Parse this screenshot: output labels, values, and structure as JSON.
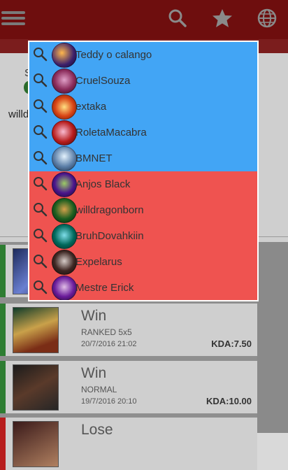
{
  "toolbar": {
    "menu_icon": "hamburger-icon",
    "search_icon": "search-icon",
    "favorite_icon": "star-icon",
    "region_icon": "globe-icon"
  },
  "profile": {
    "label_initial": "S",
    "summoner_partial": "willd"
  },
  "search_suggestions": {
    "colors": {
      "favorite": "#42a5f5",
      "recent": "#ef5350"
    },
    "favorites": [
      {
        "name": "Teddy o calango"
      },
      {
        "name": "CruelSouza"
      },
      {
        "name": "extaka"
      },
      {
        "name": "RoletaMacabra"
      },
      {
        "name": "BMNET"
      }
    ],
    "recent": [
      {
        "name": "Anjos Black"
      },
      {
        "name": "willdragonborn"
      },
      {
        "name": "BruhDovahkiin"
      },
      {
        "name": "Expelarus"
      },
      {
        "name": "Mestre Erick"
      }
    ]
  },
  "matches": [
    {
      "result": "",
      "queue": "",
      "date": "",
      "kda": ""
    },
    {
      "result": "Win",
      "queue": "RANKED 5x5",
      "date": "20/7/2016 21:02",
      "kda": "KDA:7.50"
    },
    {
      "result": "Win",
      "queue": "NORMAL",
      "date": "19/7/2016 20:10",
      "kda": "KDA:10.00"
    },
    {
      "result": "Lose",
      "queue": "",
      "date": "",
      "kda": ""
    }
  ]
}
